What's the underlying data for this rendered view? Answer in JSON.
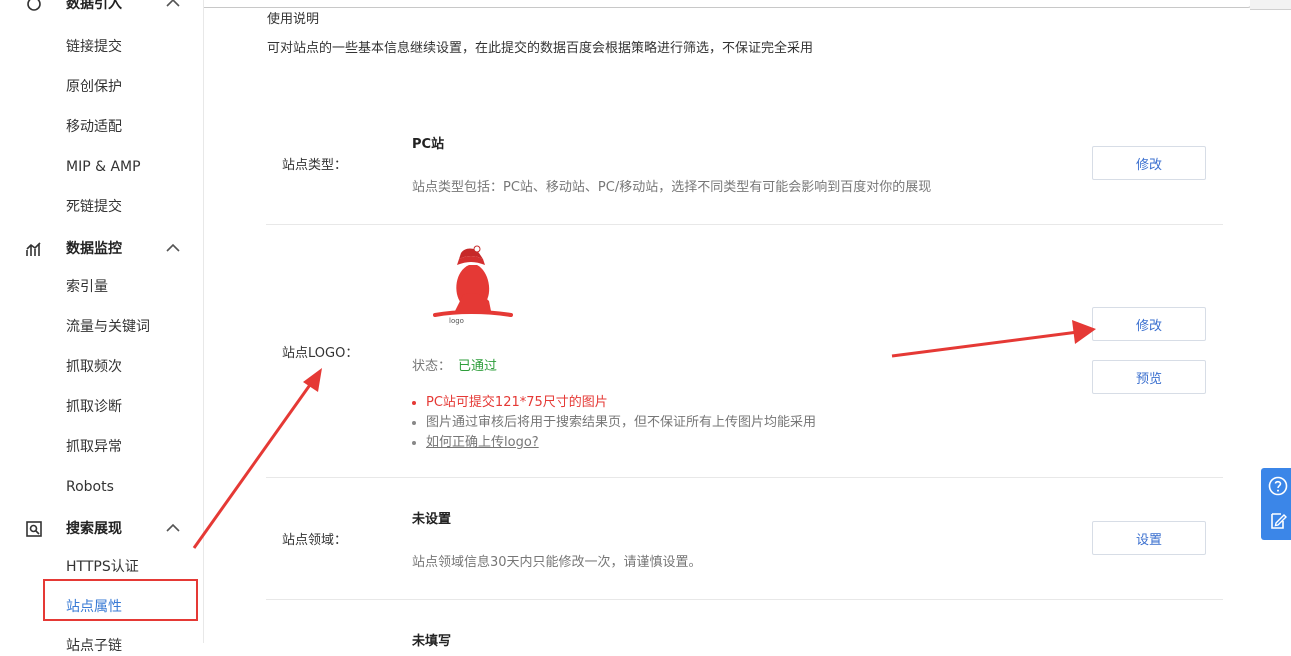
{
  "sidebar": {
    "partial_group_top": "数据引入",
    "items_group1": [
      "链接提交",
      "原创保护",
      "移动适配",
      "MIP & AMP",
      "死链提交"
    ],
    "group_monitor": "数据监控",
    "items_group2": [
      "索引量",
      "流量与关键词",
      "抓取频次",
      "抓取诊断",
      "抓取异常",
      "Robots"
    ],
    "group_search": "搜索展现",
    "items_group3": [
      "HTTPS认证",
      "站点属性"
    ],
    "partial_bottom": "站点子链"
  },
  "intro": {
    "title": "使用说明",
    "desc": "可对站点的一些基本信息继续设置，在此提交的数据百度会根据策略进行筛选，不保证完全采用"
  },
  "site_type": {
    "label": "站点类型：",
    "value": "PC站",
    "hint": "站点类型包括：PC站、移动站、PC/移动站，选择不同类型有可能会影响到百度对你的展现",
    "button": "修改"
  },
  "site_logo": {
    "label": "站点LOGO：",
    "status_label": "状态：",
    "status_value": "已通过",
    "notes": [
      "PC站可提交121*75尺寸的图片",
      "图片通过审核后将用于搜索结果页，但不保证所有上传图片均能采用",
      "如何正确上传logo?"
    ],
    "modify_button": "修改",
    "preview_button": "预览"
  },
  "site_domain": {
    "label": "站点领域：",
    "value": "未设置",
    "hint": "站点领域信息30天内只能修改一次，请谨慎设置。",
    "button": "设置"
  },
  "next_row": {
    "value": "未填写"
  },
  "colors": {
    "accent_blue": "#3a7bd5",
    "status_green": "#2e9e3b",
    "annotation_red": "#e53935"
  }
}
